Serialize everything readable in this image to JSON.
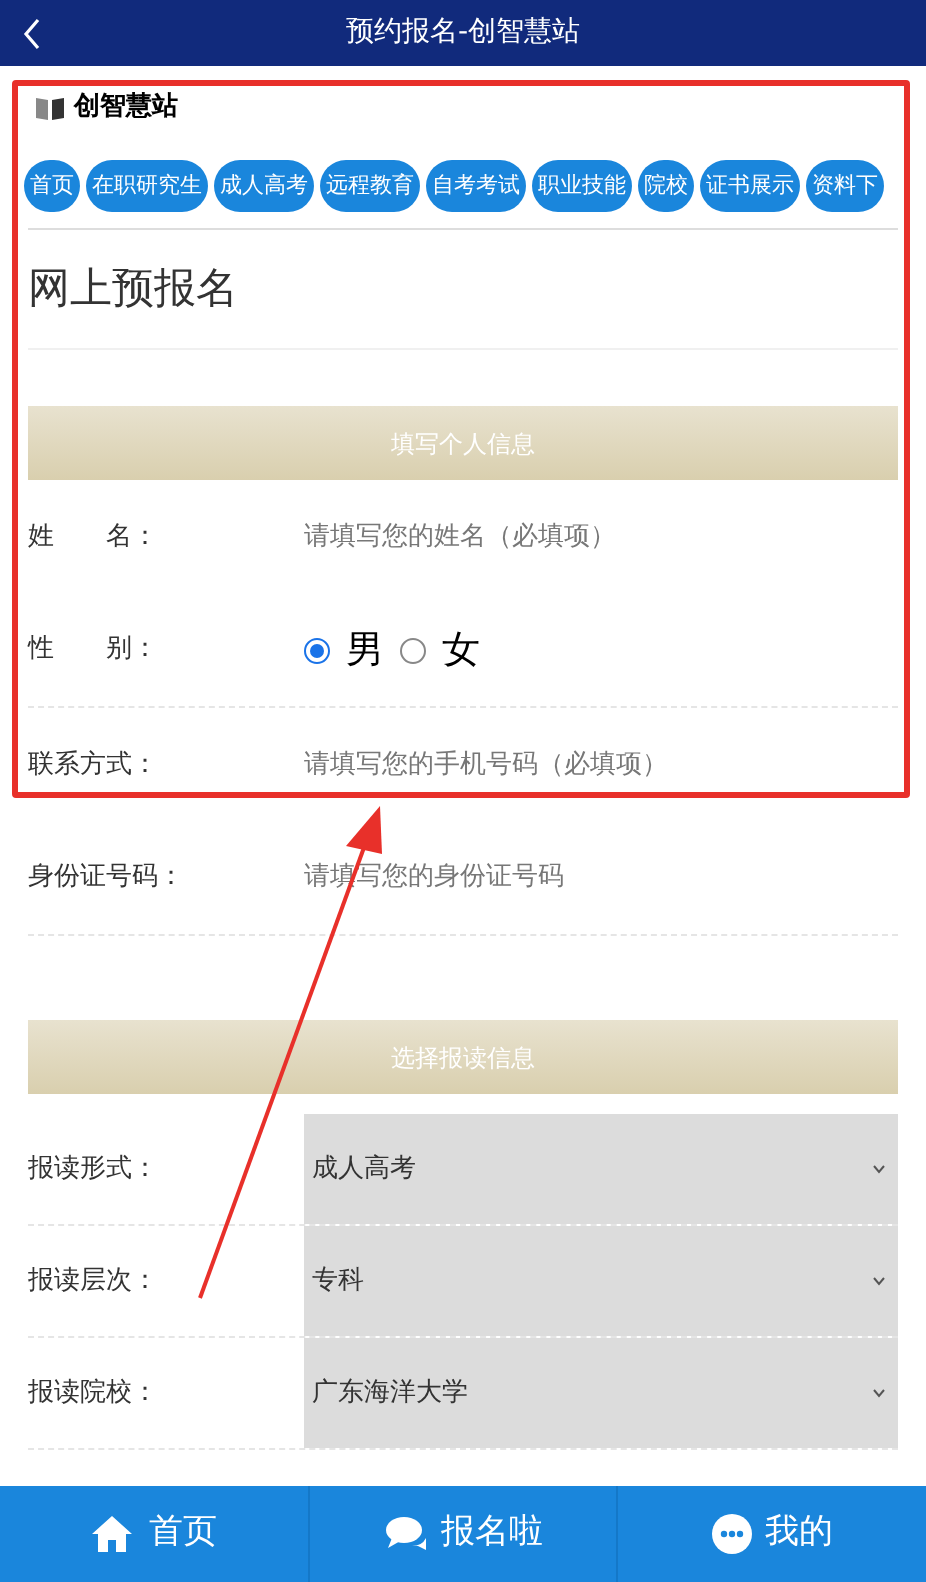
{
  "header": {
    "title": "预约报名-创智慧站"
  },
  "brand": {
    "name": "创智慧站"
  },
  "nav_pills": [
    {
      "label": "首页"
    },
    {
      "label": "在职研究生"
    },
    {
      "label": "成人高考"
    },
    {
      "label": "远程教育"
    },
    {
      "label": "自考考试"
    },
    {
      "label": "职业技能"
    },
    {
      "label": "院校"
    },
    {
      "label": "证书展示"
    },
    {
      "label": "资料下"
    }
  ],
  "page_title": "网上预报名",
  "personal_section": {
    "heading": "填写个人信息",
    "rows": [
      {
        "kind": "input",
        "label": "姓　　名：",
        "placeholder": "请填写您的姓名（必填项）"
      },
      {
        "kind": "radio",
        "label": "性　　别：",
        "options": [
          {
            "label": "男",
            "selected": true
          },
          {
            "label": "女",
            "selected": false
          }
        ]
      },
      {
        "kind": "input",
        "label": "联系方式：",
        "placeholder": "请填写您的手机号码（必填项）"
      },
      {
        "kind": "input",
        "label": "身份证号码：",
        "placeholder": "请填写您的身份证号码"
      }
    ]
  },
  "study_section": {
    "heading": "选择报读信息",
    "rows": [
      {
        "label": "报读形式：",
        "value": "成人高考"
      },
      {
        "label": "报读层次：",
        "value": "专科"
      },
      {
        "label": "报读院校：",
        "value": "广东海洋大学"
      }
    ]
  },
  "bottom_nav": [
    {
      "kind": "home",
      "label": "首页"
    },
    {
      "kind": "chat",
      "label": "报名啦"
    },
    {
      "kind": "more",
      "label": "我的"
    }
  ]
}
